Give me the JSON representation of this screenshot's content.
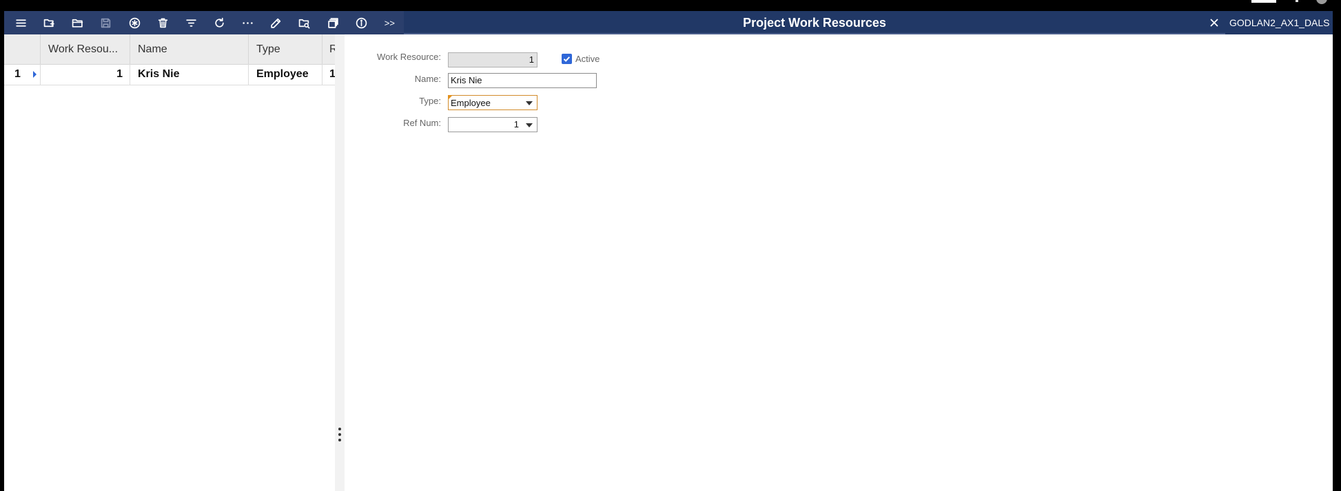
{
  "window": {
    "title": "Project Work Resources",
    "user": "GODLAN2_AX1_DALS"
  },
  "toolbar": {
    "more_label": ">>",
    "buttons": [
      {
        "icon": "menu-icon"
      },
      {
        "icon": "new-folder-icon"
      },
      {
        "icon": "open-folder-icon"
      },
      {
        "icon": "save-icon"
      },
      {
        "icon": "asterisk-icon"
      },
      {
        "icon": "trash-icon"
      },
      {
        "icon": "filter-icon"
      },
      {
        "icon": "refresh-icon"
      },
      {
        "icon": "more-icon"
      },
      {
        "icon": "pencil-icon"
      },
      {
        "icon": "search-folder-icon"
      },
      {
        "icon": "copy-icon"
      },
      {
        "icon": "info-icon"
      }
    ]
  },
  "grid": {
    "columns": [
      "Work Resou...",
      "Name",
      "Type",
      "R"
    ],
    "rows": [
      {
        "row_num": "1",
        "work_resource": "1",
        "name": "Kris Nie",
        "type": "Employee",
        "ref": "1"
      }
    ]
  },
  "form": {
    "work_resource_label": "Work Resource:",
    "work_resource_value": "1",
    "active_label": "Active",
    "active_checked": true,
    "name_label": "Name:",
    "name_value": "Kris Nie",
    "type_label": "Type:",
    "type_value": "Employee",
    "ref_num_label": "Ref Num:",
    "ref_num_value": "1"
  },
  "colors": {
    "toolbar": "#2b3f6c",
    "title_bar": "#213866",
    "accent": "#2f67d8",
    "required_flag": "#e2911f"
  }
}
